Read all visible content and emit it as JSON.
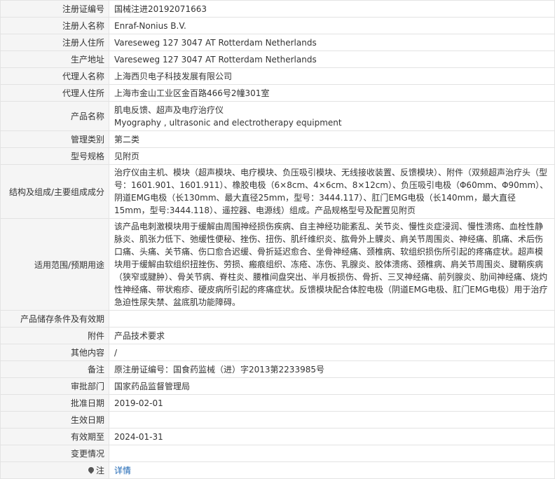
{
  "rows": [
    {
      "label": "注册证编号",
      "value": "国械注进20192071663"
    },
    {
      "label": "注册人名称",
      "value": "Enraf-Nonius B.V."
    },
    {
      "label": "注册人住所",
      "value": "Vareseweg 127 3047 AT Rotterdam Netherlands"
    },
    {
      "label": "生产地址",
      "value": "Vareseweg 127 3047 AT Rotterdam Netherlands"
    },
    {
      "label": "代理人名称",
      "value": "上海西贝电子科技发展有限公司"
    },
    {
      "label": "代理人住所",
      "value": "上海市金山工业区金百路466号2幢301室"
    },
    {
      "label": "产品名称",
      "value_cn": "肌电反馈、超声及电疗治疗仪",
      "value_en": "Myography , ultrasonic and electrotherapy equipment"
    },
    {
      "label": "管理类别",
      "value": "第二类"
    },
    {
      "label": "型号规格",
      "value": "见附页"
    },
    {
      "label": "结构及组成/主要组成成分",
      "value": "治疗仪由主机、模块（超声模块、电疗模块、负压吸引模块、无线接收装置、反馈模块）、附件（双频超声治疗头（型号：1601.901、1601.911）、橡胶电极（6×8cm、4×6cm、8×12cm）、负压吸引电极（Φ60mm、Φ90mm）、阴道EMG电极（长130mm、最大直径25mm，型号：3444.117）、肛门EMG电极（长140mm，最大直径15mm，型号:3444.118）、遥控器、电源线）组成。产品规格型号及配置见附页"
    },
    {
      "label": "适用范围/预期用途",
      "value": "该产品电刺激模块用于缓解由周围神经损伤疾病、自主神经功能紊乱、关节炎、慢性炎症浸润、慢性溃疡、血栓性静脉炎、肌张力低下、弛缓性便秘、挫伤、扭伤、肌纤维织炎、肱骨外上髁炎、肩关节周围炎、神经痛、肌痛、术后伤口痛、头痛、关节痛、伤口愈合迟缓、骨折延迟愈合、坐骨神经痛、颈椎病、软组织损伤所引起的疼痛症状。超声模块用于缓解由软组织扭挫伤、劳损、瘢痕组织、冻疮、冻伤、乳腺炎、胶体溃疡、颈椎病、肩关节周围炎、腱鞘疾病（狭窄或腱肿）、骨关节病、脊柱炎、腰椎间盘突出、半月板损伤、骨折、三叉神经痛、前列腺炎、肋间神经痛、烧灼性神经痛、带状疱疹、硬皮病所引起的疼痛症状。反馈模块配合体腔电极（阴道EMG电极、肛门EMG电极）用于治疗急迫性尿失禁、盆底肌功能障碍。"
    },
    {
      "label": "产品储存条件及有效期",
      "value": ""
    },
    {
      "label": "附件",
      "value": "产品技术要求"
    },
    {
      "label": "其他内容",
      "value": "/"
    },
    {
      "label": "备注",
      "value": "原注册证编号：国食药监械（进）字2013第2233985号"
    },
    {
      "label": "审批部门",
      "value": "国家药品监督管理局"
    },
    {
      "label": "批准日期",
      "value": "2019-02-01"
    },
    {
      "label": "生效日期",
      "value": ""
    },
    {
      "label": "有效期至",
      "value": "2024-01-31"
    },
    {
      "label": "变更情况",
      "value": ""
    },
    {
      "label": "注",
      "value": "详情",
      "icon": "pin-icon"
    }
  ]
}
